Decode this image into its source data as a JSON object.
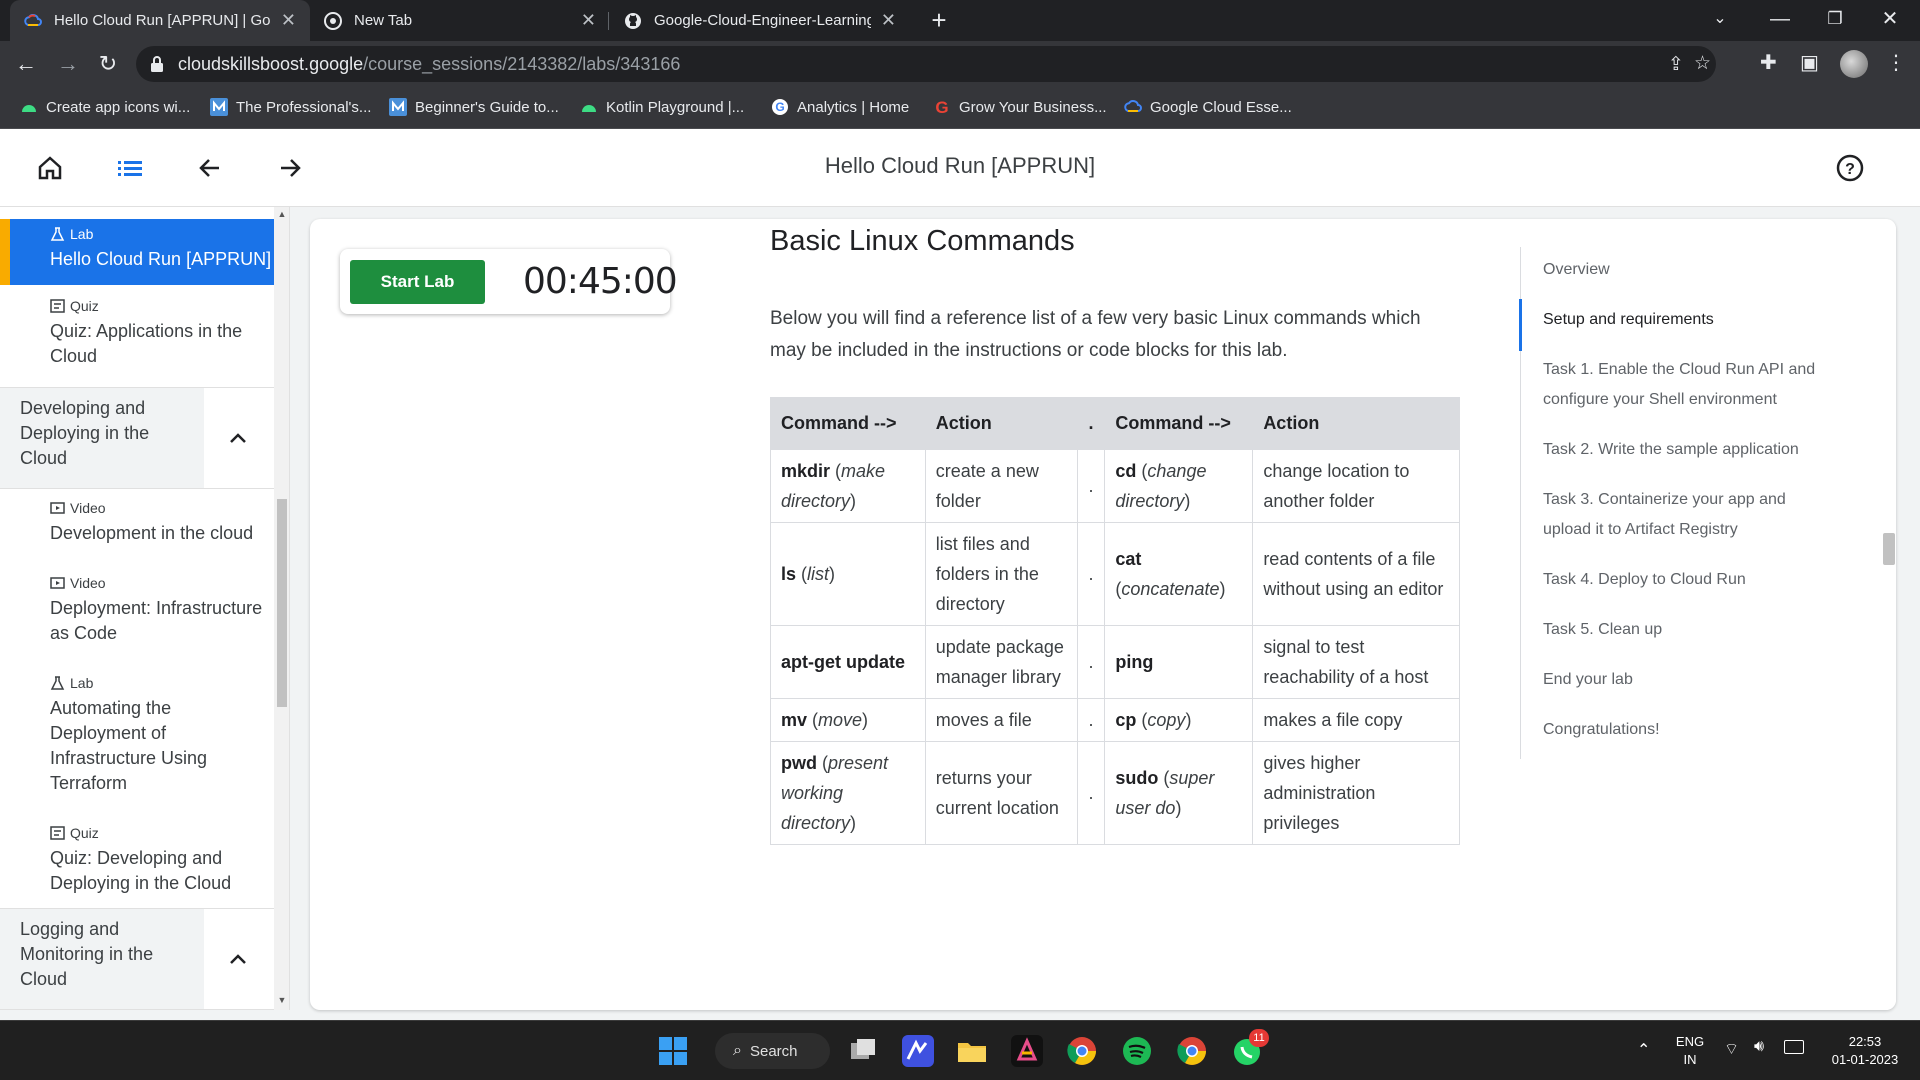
{
  "browser": {
    "tabs": [
      {
        "title": "Hello Cloud Run [APPRUN] | Goo",
        "active": true,
        "favicon": "google-cloud-icon"
      },
      {
        "title": "New Tab",
        "active": false,
        "favicon": "chrome-icon"
      },
      {
        "title": "Google-Cloud-Engineer-Learning",
        "active": false,
        "favicon": "github-icon"
      }
    ],
    "url_domain": "cloudskillsboost.google",
    "url_path": "/course_sessions/2143382/labs/343166",
    "bookmarks": [
      "Create app icons wi...",
      "The Professional's...",
      "Beginner's Guide to...",
      "Kotlin Playground  |...",
      "Analytics | Home",
      "Grow Your Business...",
      "Google Cloud Esse..."
    ]
  },
  "header": {
    "title": "Hello Cloud Run [APPRUN]"
  },
  "sidebar": {
    "items": [
      {
        "kind": "Lab",
        "name": "Hello Cloud Run [APPRUN]",
        "active": true
      },
      {
        "kind": "Quiz",
        "name": "Quiz: Applications in the Cloud"
      },
      {
        "section": "Developing and Deploying in the Cloud"
      },
      {
        "kind": "Video",
        "name": "Development in the cloud"
      },
      {
        "kind": "Video",
        "name": "Deployment: Infrastructure as Code"
      },
      {
        "kind": "Lab",
        "name": "Automating the Deployment of Infrastructure Using Terraform"
      },
      {
        "kind": "Quiz",
        "name": "Quiz: Developing and Deploying in the Cloud"
      },
      {
        "section": "Logging and Monitoring in the Cloud"
      }
    ]
  },
  "lab": {
    "start_label": "Start Lab",
    "timer": "00:45:00"
  },
  "doc": {
    "heading": "Basic Linux Commands",
    "intro": "Below you will find a reference list of a few very basic Linux commands which may be included in the instructions or code blocks for this lab.",
    "table": {
      "headers": [
        "Command -->",
        "Action",
        ".",
        "Command -->",
        "Action"
      ],
      "rows": [
        {
          "cmd1": "mkdir",
          "cmd1_desc": "make directory",
          "act1": "create a new folder",
          "cmd2": "cd",
          "cmd2_desc": "change directory",
          "act2": "change location to another folder"
        },
        {
          "cmd1": "ls",
          "cmd1_desc": "list",
          "act1": "list files and folders in the directory",
          "cmd2": "cat",
          "cmd2_desc": "concatenate",
          "act2": "read contents of a file without using an editor"
        },
        {
          "cmd1": "apt-get update",
          "cmd1_desc": "",
          "act1": "update package manager library",
          "cmd2": "ping",
          "cmd2_desc": "",
          "act2": "signal to test reachability of a host"
        },
        {
          "cmd1": "mv",
          "cmd1_desc": "move",
          "act1": "moves a file",
          "cmd2": "cp",
          "cmd2_desc": "copy",
          "act2": "makes a file copy"
        },
        {
          "cmd1": "pwd",
          "cmd1_desc": "present working directory",
          "act1": "returns your current location",
          "cmd2": "sudo",
          "cmd2_desc": "super user do",
          "act2": "gives higher administration privileges"
        }
      ]
    }
  },
  "toc": [
    {
      "label": "Overview"
    },
    {
      "label": "Setup and requirements",
      "active": true
    },
    {
      "label": "Task 1. Enable the Cloud Run API and configure your Shell environment"
    },
    {
      "label": "Task 2. Write the sample application"
    },
    {
      "label": "Task 3. Containerize your app and upload it to Artifact Registry"
    },
    {
      "label": "Task 4. Deploy to Cloud Run"
    },
    {
      "label": "Task 5. Clean up"
    },
    {
      "label": "End your lab"
    },
    {
      "label": "Congratulations!"
    }
  ],
  "taskbar": {
    "search_label": "Search",
    "lang": "ENG",
    "region": "IN",
    "time": "22:53",
    "date": "01-01-2023",
    "whatsapp_badge": "11"
  },
  "colors": {
    "accent_blue": "#1a73e8",
    "start_green": "#1e8e3e",
    "active_marker": "#f9ab00"
  }
}
